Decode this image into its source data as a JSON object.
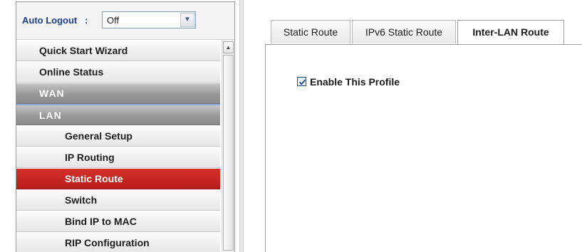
{
  "auto_logout": {
    "label": "Auto Logout",
    "colon": ":",
    "selected_value": "Off"
  },
  "menu": {
    "items": [
      {
        "label": "Quick Start Wizard",
        "kind": "item"
      },
      {
        "label": "Online Status",
        "kind": "item"
      },
      {
        "label": "WAN",
        "kind": "group"
      },
      {
        "label": "LAN",
        "kind": "group"
      },
      {
        "label": "General Setup",
        "kind": "sub"
      },
      {
        "label": "IP Routing",
        "kind": "sub"
      },
      {
        "label": "Static Route",
        "kind": "sub-active"
      },
      {
        "label": "Switch",
        "kind": "sub"
      },
      {
        "label": "Bind IP to MAC",
        "kind": "sub"
      },
      {
        "label": "RIP Configuration",
        "kind": "sub"
      }
    ]
  },
  "tabs": [
    {
      "label": "Static Route",
      "active": false
    },
    {
      "label": "IPv6 Static Route",
      "active": false
    },
    {
      "label": "Inter-LAN Route",
      "active": true
    }
  ],
  "panel": {
    "enable_label": "Enable This Profile",
    "enable_checked": true
  },
  "colors": {
    "active_menu": "#c82520",
    "group_header": "#989898",
    "label_blue": "#1f3f86"
  },
  "icons": {
    "dropdown": "chevron-down-icon",
    "scroll_up": "scroll-up-arrow-icon",
    "checkbox": "checkmark-icon"
  }
}
